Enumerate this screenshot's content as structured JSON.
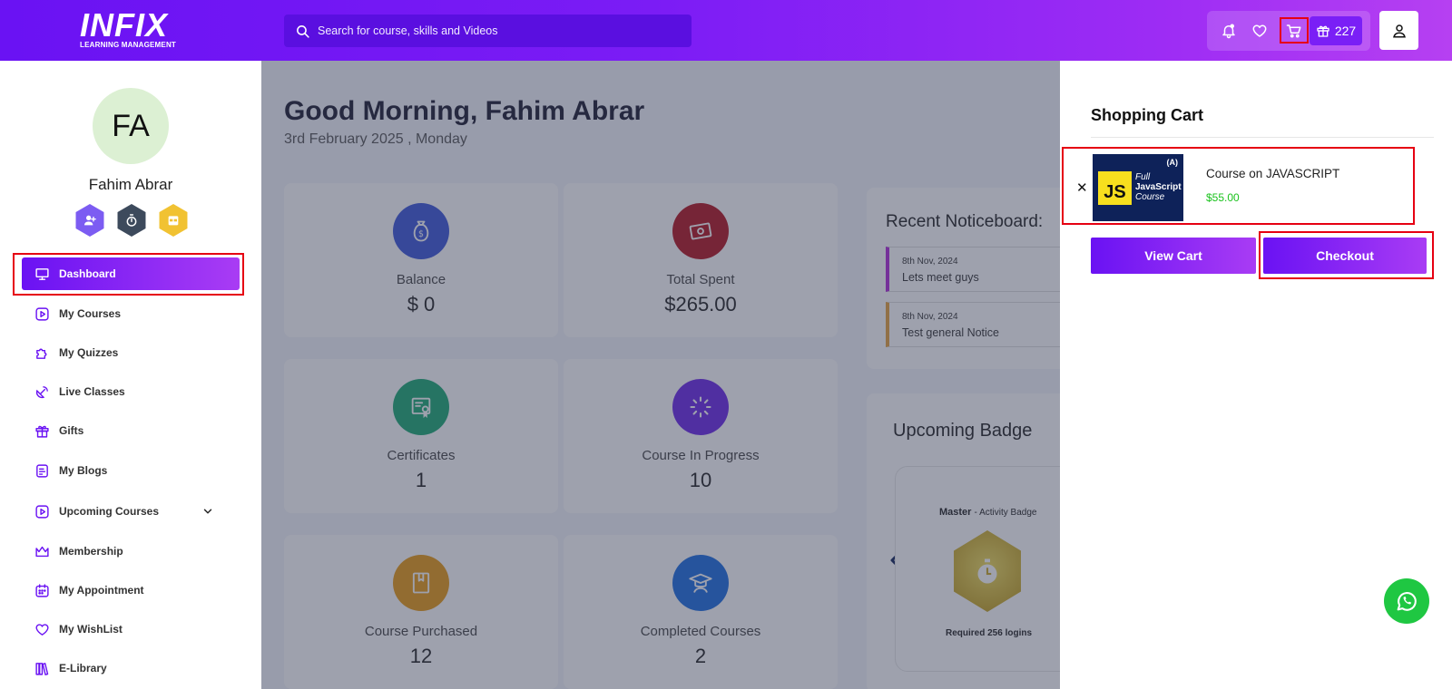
{
  "header": {
    "logo_main": "INFIX",
    "logo_sub": "LEARNING MANAGEMENT",
    "search_placeholder": "Search for course, skills and Videos",
    "gift_points": "227"
  },
  "sidebar": {
    "avatar_initials": "FA",
    "user_name": "Fahim Abrar",
    "items": [
      {
        "label": "Dashboard",
        "icon": "monitor-icon"
      },
      {
        "label": "My Courses",
        "icon": "play-square-icon"
      },
      {
        "label": "My Quizzes",
        "icon": "puzzle-icon"
      },
      {
        "label": "Live Classes",
        "icon": "satellite-icon"
      },
      {
        "label": "Gifts",
        "icon": "gift-icon"
      },
      {
        "label": "My Blogs",
        "icon": "document-icon"
      },
      {
        "label": "Upcoming Courses",
        "icon": "play-square-icon"
      },
      {
        "label": "Membership",
        "icon": "crown-icon"
      },
      {
        "label": "My Appointment",
        "icon": "calendar-icon"
      },
      {
        "label": "My WishList",
        "icon": "heart-icon"
      },
      {
        "label": "E-Library",
        "icon": "books-icon"
      }
    ]
  },
  "main": {
    "greeting": "Good Morning, Fahim Abrar",
    "date": "3rd February 2025 , Monday",
    "stats": [
      {
        "label": "Balance",
        "value": "$ 0",
        "color": "#3a55d9"
      },
      {
        "label": "Total Spent",
        "value": "$265.00",
        "color": "#b3121e"
      },
      {
        "label": "Certificates",
        "value": "1",
        "color": "#19a972"
      },
      {
        "label": "Course In Progress",
        "value": "10",
        "color": "#6a25e8"
      },
      {
        "label": "Course Purchased",
        "value": "12",
        "color": "#e89a12"
      },
      {
        "label": "Completed Courses",
        "value": "2",
        "color": "#1a6be0"
      }
    ],
    "noticeboard": {
      "title": "Recent Noticeboard:",
      "notices": [
        {
          "date": "8th Nov, 2024",
          "text": "Lets meet guys"
        },
        {
          "date": "8th Nov, 2024",
          "text": "Test general Notice"
        }
      ]
    },
    "upcoming_badge": {
      "title": "Upcoming Badge",
      "badge_name": "Master",
      "badge_type": "- Activity Badge",
      "requirement": "Required 256 logins"
    }
  },
  "cart": {
    "title": "Shopping Cart",
    "items": [
      {
        "name": "Course on JAVASCRIPT",
        "price": "$55.00",
        "thumb_text": [
          "Full",
          "JavaScript",
          "Course"
        ],
        "thumb_badge": "JS"
      }
    ],
    "view_cart_label": "View Cart",
    "checkout_label": "Checkout"
  }
}
